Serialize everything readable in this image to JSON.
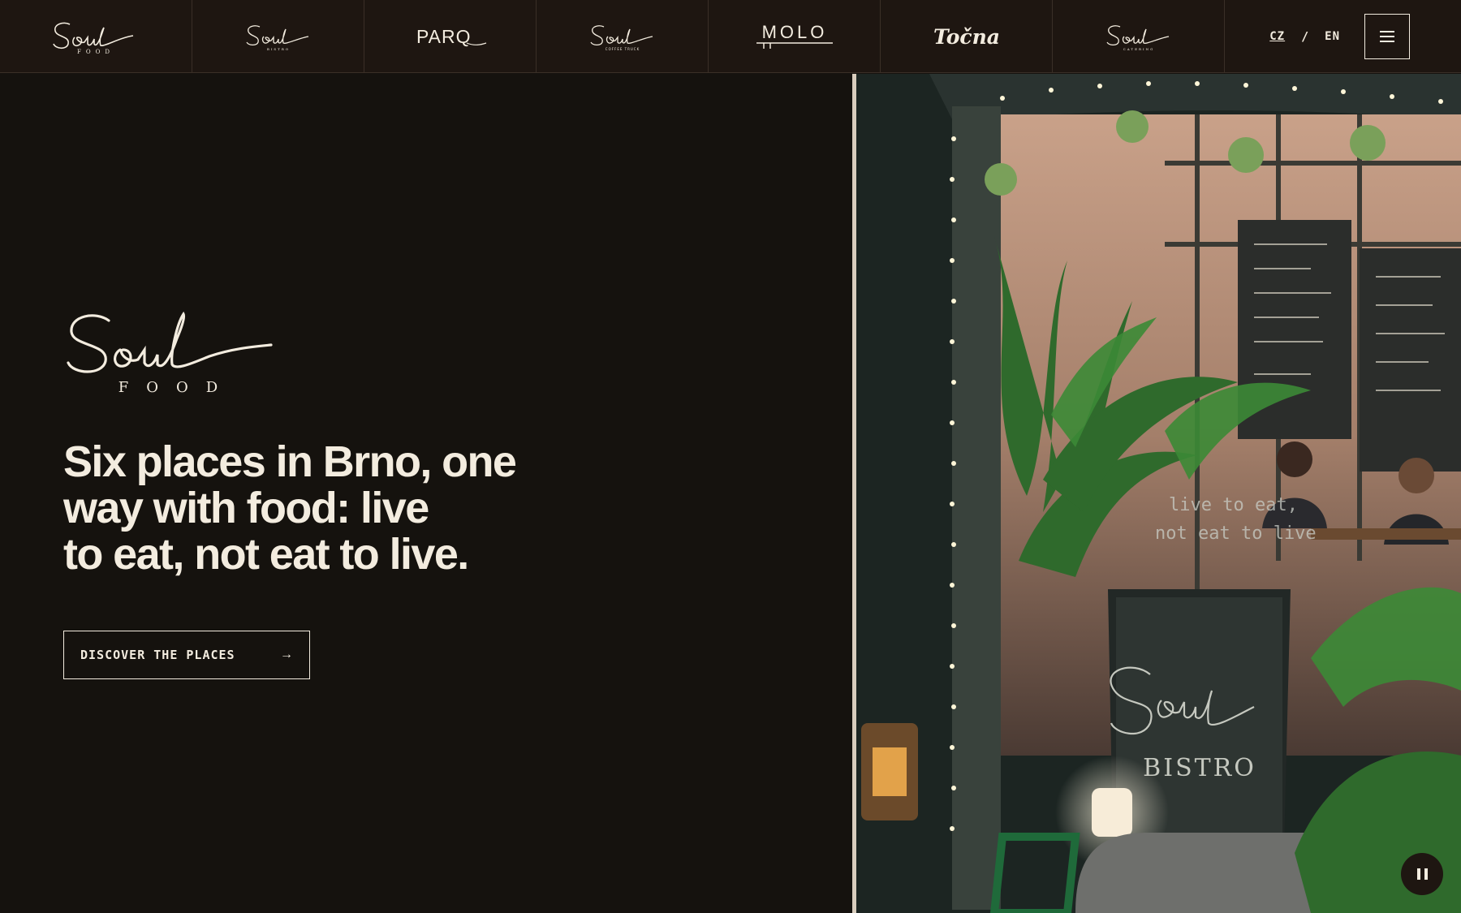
{
  "nav": {
    "brands": [
      {
        "name": "Soul",
        "sub": "FOOD"
      },
      {
        "name": "Soul",
        "sub": "BISTRO"
      },
      {
        "name": "PARQ",
        "sub": ""
      },
      {
        "name": "Soul",
        "sub": "COFFEE TRUCK"
      },
      {
        "name": "MOLO",
        "sub": ""
      },
      {
        "name": "Točna",
        "sub": ""
      },
      {
        "name": "Soul",
        "sub": "CATERING"
      }
    ],
    "lang_cz": "CZ",
    "lang_separator": "/",
    "lang_en": "EN",
    "menu_icon": "hamburger-icon"
  },
  "hero": {
    "logo_name": "Soul",
    "logo_sub": "FOOD",
    "title_lines": [
      "Six places in Brno, one",
      "way with food: live",
      "to eat, not eat to live."
    ],
    "cta_label": "DISCOVER THE PLACES",
    "cta_arrow": "→"
  },
  "photo": {
    "window_text_line1": "live to eat,",
    "window_text_line2": "not eat to live",
    "sign_script": "Soul",
    "sign_label": "BISTRO",
    "pause_icon": "pause-icon"
  },
  "colors": {
    "background": "#15120e",
    "nav_background": "#1e1611",
    "text": "#f3ecdf",
    "divider": "#d8cdbd"
  }
}
